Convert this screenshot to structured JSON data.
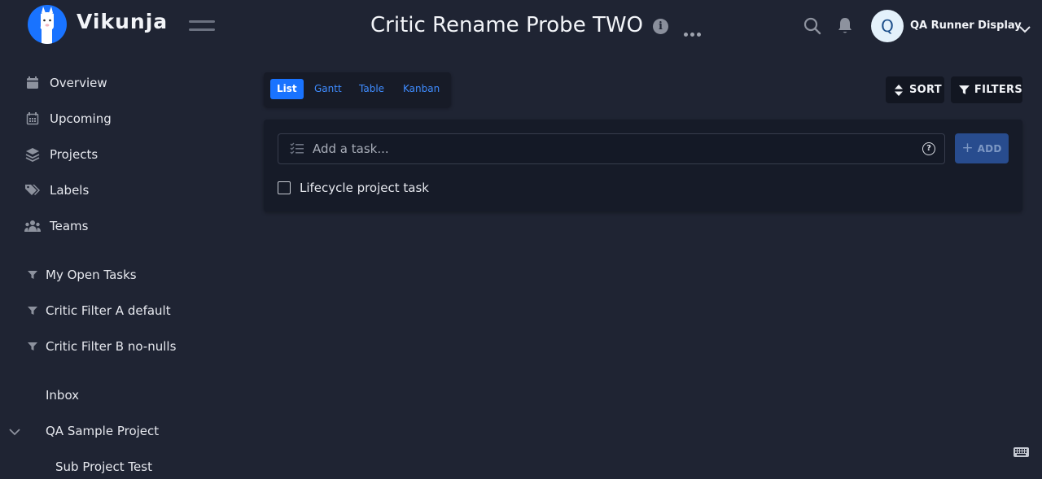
{
  "app": {
    "name": "Vikunja",
    "brand_color": "#1973ff"
  },
  "header": {
    "title": "Critic Rename Probe TWO",
    "user": {
      "initial": "Q",
      "name": "QA Runner Display"
    }
  },
  "sidebar": {
    "nav": [
      {
        "label": "Overview",
        "icon": "calendar-icon"
      },
      {
        "label": "Upcoming",
        "icon": "calendar-grid-icon"
      },
      {
        "label": "Projects",
        "icon": "layers-icon"
      },
      {
        "label": "Labels",
        "icon": "tags-icon"
      },
      {
        "label": "Teams",
        "icon": "users-icon"
      }
    ],
    "filters": [
      {
        "label": "My Open Tasks"
      },
      {
        "label": "Critic Filter A default"
      },
      {
        "label": "Critic Filter B no-nulls"
      }
    ],
    "projects": [
      {
        "label": "Inbox"
      },
      {
        "label": "QA Sample Project"
      },
      {
        "label": "Sub Project Test"
      }
    ]
  },
  "views": {
    "tabs": [
      {
        "label": "List",
        "active": true
      },
      {
        "label": "Gantt",
        "active": false
      },
      {
        "label": "Table",
        "active": false
      },
      {
        "label": "Kanban",
        "active": false
      }
    ]
  },
  "actions": {
    "sort_label": "SORT",
    "filters_label": "FILTERS"
  },
  "task_list": {
    "input_placeholder": "Add a task...",
    "add_label": "ADD",
    "tasks": [
      {
        "title": "Lifecycle project task",
        "done": false
      }
    ]
  }
}
